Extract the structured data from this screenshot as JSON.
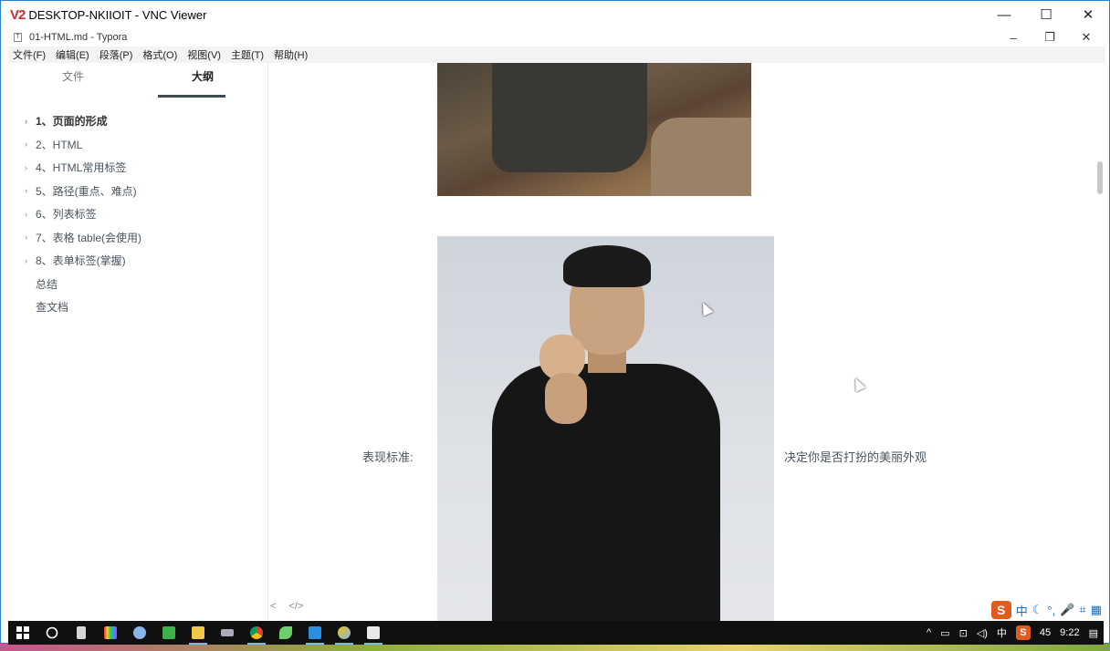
{
  "vnc": {
    "logo": "V2",
    "title": "DESKTOP-NKIIOIT - VNC Viewer",
    "controls": [
      "—",
      "☐",
      "✕"
    ]
  },
  "typora": {
    "title": "01-HTML.md - Typora",
    "file_icon": "T",
    "controls": [
      "–",
      "❐",
      "✕"
    ],
    "menu": [
      "文件(F)",
      "编辑(E)",
      "段落(P)",
      "格式(O)",
      "视图(V)",
      "主题(T)",
      "帮助(H)"
    ],
    "sidebar": {
      "tabs": [
        "文件",
        "大纲"
      ],
      "active_tab": "大纲",
      "outline": [
        {
          "label": "1、页面的形成",
          "bold": true,
          "chevron": true
        },
        {
          "label": "2、HTML",
          "bold": false,
          "chevron": true
        },
        {
          "label": "4、HTML常用标签",
          "bold": false,
          "chevron": true
        },
        {
          "label": "5、路径(重点、难点)",
          "bold": false,
          "chevron": true
        },
        {
          "label": "6、列表标签",
          "bold": false,
          "chevron": true
        },
        {
          "label": "7、表格 table(会使用)",
          "bold": false,
          "chevron": true
        },
        {
          "label": "8、表单标签(掌握)",
          "bold": false,
          "chevron": true
        },
        {
          "label": "总结",
          "bold": false,
          "chevron": false
        },
        {
          "label": "查文档",
          "bold": false,
          "chevron": false
        }
      ],
      "footer": [
        "<",
        "</>"
      ]
    },
    "content": {
      "caption_left": "表现标准:",
      "caption_right": "决定你是否打扮的美丽外观"
    },
    "ime": {
      "logo": "S",
      "items": [
        "中",
        "☾",
        "°,",
        "🎤",
        "⌗",
        "▦"
      ]
    }
  },
  "taskbar": {
    "icons": [
      "windows-start-icon",
      "search-circle-icon",
      "calculator-icon",
      "color-palette-icon",
      "paint-icon",
      "hbuilder-icon",
      "file-explorer-icon",
      "media-icon",
      "chrome-icon",
      "leaf-icon",
      "vscode-icon",
      "weather-icon",
      "typora-icon"
    ],
    "tray": {
      "chevron": "^",
      "ime_lang": "中",
      "sogou": "S",
      "badge": "45",
      "time": "9:22"
    }
  },
  "colors": {
    "accent": "#3e4a55",
    "vnc_border": "#2a7fd1",
    "sogou": "#e25a1c"
  }
}
